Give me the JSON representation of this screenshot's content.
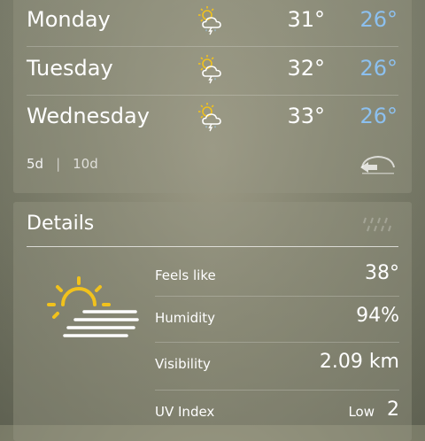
{
  "forecast": {
    "days": [
      {
        "name": "Monday",
        "high": "31°",
        "low": "26°",
        "icon": "thunderstorm-partly-sunny-icon"
      },
      {
        "name": "Tuesday",
        "high": "32°",
        "low": "26°",
        "icon": "thunderstorm-partly-sunny-icon"
      },
      {
        "name": "Wednesday",
        "high": "33°",
        "low": "26°",
        "icon": "thunderstorm-partly-sunny-icon"
      }
    ],
    "range_options": [
      "5d",
      "10d"
    ],
    "selected_range": "5d",
    "provider_icon": "weather-underground-logo"
  },
  "details": {
    "title": "Details",
    "icon": "sun-haze-icon",
    "rows": [
      {
        "label": "Feels like",
        "value": "38°"
      },
      {
        "label": "Humidity",
        "value": "94%"
      },
      {
        "label": "Visibility",
        "value": "2.09 km"
      }
    ],
    "uv": {
      "label": "UV Index",
      "level": "Low",
      "value": "2"
    }
  },
  "colors": {
    "high": "#ffffff",
    "low": "#8cc0ef",
    "icon_sun": "#f1c21c",
    "accent": "#8cc0ef"
  }
}
